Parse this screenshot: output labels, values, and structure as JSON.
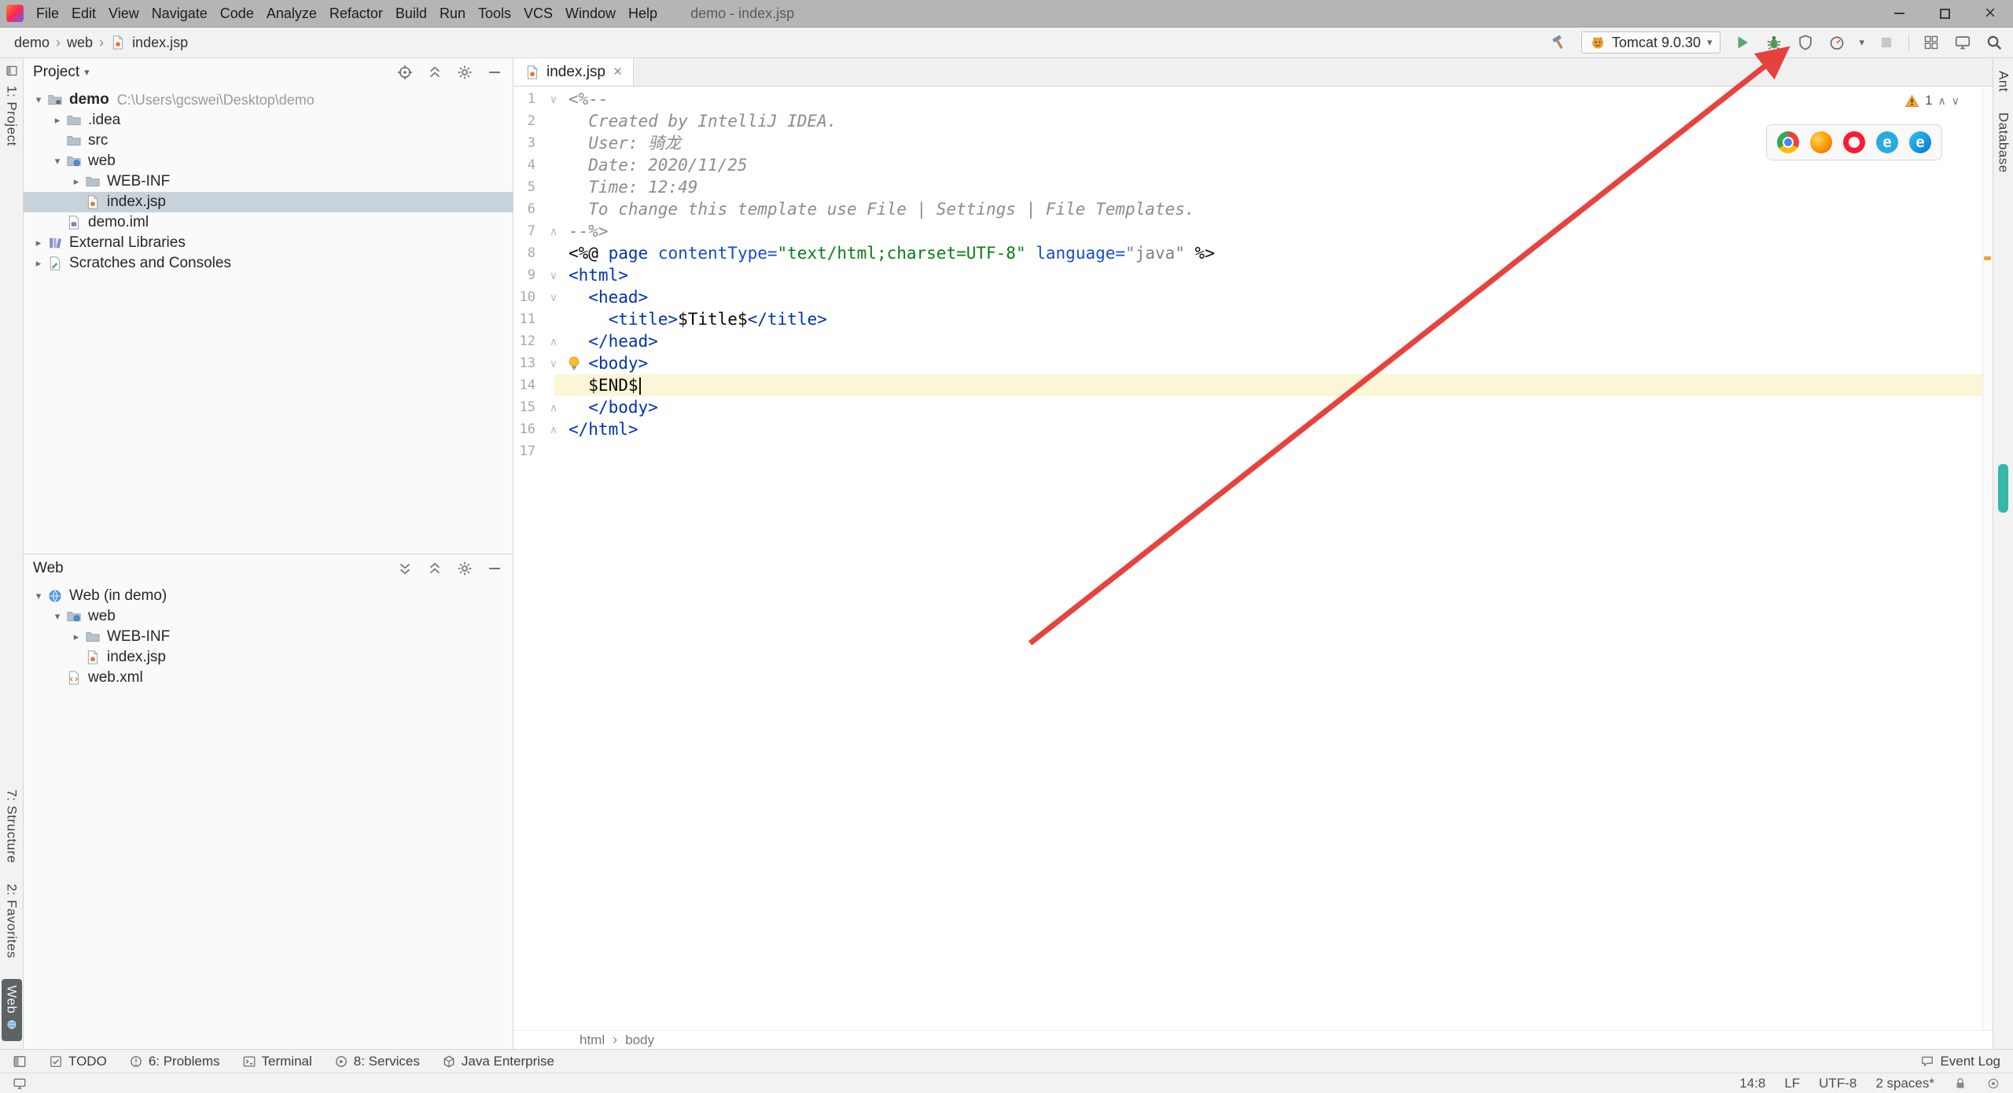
{
  "colors": {
    "selection": "#c8d2da",
    "currentline": "#fcf6d8",
    "warning": "#f2a33a",
    "arrow": "#e53935",
    "run": "#59a869"
  },
  "window": {
    "title": "demo - index.jsp"
  },
  "menu": {
    "items": [
      "File",
      "Edit",
      "View",
      "Navigate",
      "Code",
      "Analyze",
      "Refactor",
      "Build",
      "Run",
      "Tools",
      "VCS",
      "Window",
      "Help"
    ]
  },
  "nav_breadcrumb": [
    {
      "label": "demo"
    },
    {
      "label": "web"
    },
    {
      "label": "index.jsp",
      "icon": "jsp-file"
    }
  ],
  "toolbar": {
    "run_config": "Tomcat 9.0.30"
  },
  "left_stripe": {
    "top": [
      {
        "label": "1: Project",
        "icon": "project-tool",
        "selected": false
      }
    ],
    "bottom": [
      {
        "label": "7: Structure"
      },
      {
        "label": "2: Favorites"
      },
      {
        "label": "Web",
        "icon": "globe",
        "selected": true
      }
    ]
  },
  "right_stripe": {
    "items": [
      "Ant",
      "Database"
    ]
  },
  "project_panel": {
    "title": "Project",
    "tree": [
      {
        "label": "demo",
        "hint": "C:\\Users\\gcswei\\Desktop\\demo",
        "depth": 0,
        "icon": "project-folder",
        "arrow": true,
        "expanded": true,
        "bold": true
      },
      {
        "label": ".idea",
        "depth": 1,
        "icon": "folder",
        "arrow": true,
        "expanded": false
      },
      {
        "label": "src",
        "depth": 1,
        "icon": "folder"
      },
      {
        "label": "web",
        "depth": 1,
        "icon": "web-folder",
        "arrow": true,
        "expanded": true
      },
      {
        "label": "WEB-INF",
        "depth": 2,
        "icon": "folder",
        "arrow": true,
        "expanded": false
      },
      {
        "label": "index.jsp",
        "depth": 2,
        "icon": "jsp-file",
        "selected": true
      },
      {
        "label": "demo.iml",
        "depth": 1,
        "icon": "iml-file"
      },
      {
        "label": "External Libraries",
        "depth": 0,
        "icon": "libraries",
        "arrow": true,
        "expanded": false
      },
      {
        "label": "Scratches and Consoles",
        "depth": 0,
        "icon": "scratches",
        "arrow": true,
        "expanded": false
      }
    ]
  },
  "web_panel": {
    "title": "Web",
    "tree": [
      {
        "label": "Web (in demo)",
        "depth": 0,
        "icon": "web-facet",
        "arrow": true,
        "expanded": true
      },
      {
        "label": "web",
        "depth": 1,
        "icon": "web-folder",
        "arrow": true,
        "expanded": true
      },
      {
        "label": "WEB-INF",
        "depth": 2,
        "icon": "folder",
        "arrow": true,
        "expanded": false
      },
      {
        "label": "index.jsp",
        "depth": 2,
        "icon": "jsp-file"
      },
      {
        "label": "web.xml",
        "depth": 1,
        "icon": "xml-file"
      }
    ]
  },
  "editor": {
    "tab": "index.jsp",
    "breadcrumbs": [
      "html",
      "body"
    ],
    "inspection_count": "1",
    "browsers": [
      "Chrome",
      "Firefox",
      "Opera",
      "Internet Explorer",
      "Edge"
    ],
    "lines": [
      {
        "n": 1,
        "fold": "down",
        "segs": [
          {
            "t": "<%--",
            "c": "comment"
          }
        ]
      },
      {
        "n": 2,
        "segs": [
          {
            "t": "  Created by IntelliJ IDEA.",
            "c": "comment"
          }
        ]
      },
      {
        "n": 3,
        "segs": [
          {
            "t": "  User: 骑龙",
            "c": "comment"
          }
        ]
      },
      {
        "n": 4,
        "segs": [
          {
            "t": "  Date: 2020/11/25",
            "c": "comment"
          }
        ]
      },
      {
        "n": 5,
        "segs": [
          {
            "t": "  Time: 12:49",
            "c": "comment"
          }
        ]
      },
      {
        "n": 6,
        "segs": [
          {
            "t": "  To change this template use File | Settings | File Templates.",
            "c": "comment"
          }
        ]
      },
      {
        "n": 7,
        "fold": "up",
        "segs": [
          {
            "t": "--%>",
            "c": "comment"
          }
        ]
      },
      {
        "n": 8,
        "segs": [
          {
            "t": "<%@ ",
            "c": "plain"
          },
          {
            "t": "page ",
            "c": "keyword"
          },
          {
            "t": "contentType=",
            "c": "attr"
          },
          {
            "t": "\"text/html;charset=UTF-8\"",
            "c": "string"
          },
          {
            "t": " ",
            "c": "plain"
          },
          {
            "t": "language=",
            "c": "attr"
          },
          {
            "t": "\"java\"",
            "c": "muted"
          },
          {
            "t": " %>",
            "c": "plain"
          }
        ]
      },
      {
        "n": 9,
        "fold": "down",
        "segs": [
          {
            "t": "<html>",
            "c": "tag"
          }
        ]
      },
      {
        "n": 10,
        "fold": "down",
        "segs": [
          {
            "t": "  ",
            "c": "plain"
          },
          {
            "t": "<head>",
            "c": "tag"
          }
        ]
      },
      {
        "n": 11,
        "segs": [
          {
            "t": "    ",
            "c": "plain"
          },
          {
            "t": "<title>",
            "c": "tag"
          },
          {
            "t": "$Title$",
            "c": "plain"
          },
          {
            "t": "</title>",
            "c": "tag"
          }
        ]
      },
      {
        "n": 12,
        "fold": "up",
        "segs": [
          {
            "t": "  ",
            "c": "plain"
          },
          {
            "t": "</head>",
            "c": "tag"
          }
        ]
      },
      {
        "n": 13,
        "fold": "down",
        "bulb": true,
        "segs": [
          {
            "t": "  ",
            "c": "plain"
          },
          {
            "t": "<body>",
            "c": "tag"
          }
        ]
      },
      {
        "n": 14,
        "current": true,
        "caret": true,
        "segs": [
          {
            "t": "  $END$",
            "c": "plain"
          }
        ]
      },
      {
        "n": 15,
        "fold": "up",
        "segs": [
          {
            "t": "  ",
            "c": "plain"
          },
          {
            "t": "</body>",
            "c": "tag"
          }
        ]
      },
      {
        "n": 16,
        "fold": "up",
        "segs": [
          {
            "t": "</html>",
            "c": "tag"
          }
        ]
      },
      {
        "n": 17,
        "segs": []
      }
    ]
  },
  "bottom_stripe": {
    "items": [
      {
        "label": "TODO",
        "icon": "todo"
      },
      {
        "label": "6: Problems",
        "icon": "problems"
      },
      {
        "label": "Terminal",
        "icon": "terminal"
      },
      {
        "label": "8: Services",
        "icon": "services"
      },
      {
        "label": "Java Enterprise",
        "icon": "javaee"
      }
    ],
    "event_log": "Event Log"
  },
  "status_bar": {
    "position": "14:8",
    "line_sep": "LF",
    "encoding": "UTF-8",
    "indent": "2 spaces*"
  }
}
